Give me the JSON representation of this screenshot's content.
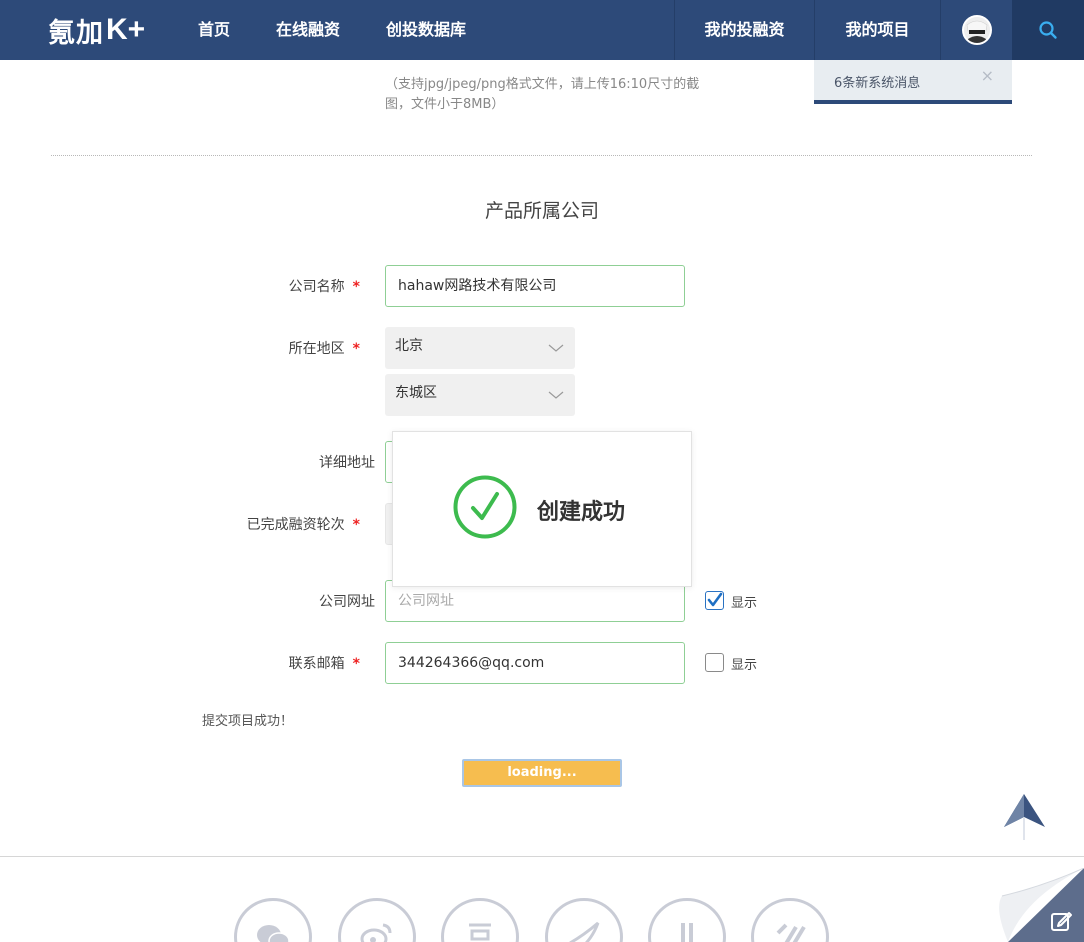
{
  "header": {
    "logo_text": "氪加",
    "logo_mark": "K+",
    "nav": [
      "首页",
      "在线融资",
      "创投数据库"
    ],
    "right_nav": [
      "我的投融资",
      "我的项目"
    ]
  },
  "notification": {
    "text": "6条新系统消息",
    "close": "×"
  },
  "upload_hint": "（支持jpg/jpeg/png格式文件，请上传16:10尺寸的截图，文件小于8MB）",
  "section_title": "产品所属公司",
  "form": {
    "required_mark": "*",
    "company_name": {
      "label": "公司名称",
      "value": "hahaw网路技术有限公司"
    },
    "region": {
      "label": "所在地区",
      "province": "北京",
      "district": "东城区"
    },
    "address": {
      "label": "详细地址"
    },
    "rounds": {
      "label": "已完成融资轮次"
    },
    "website": {
      "label": "公司网址",
      "placeholder": "公司网址",
      "show_label": "显示",
      "show_checked": true
    },
    "email": {
      "label": "联系邮箱",
      "value": "344264366@qq.com",
      "show_label": "显示",
      "show_checked": false
    }
  },
  "toast": {
    "text": "创建成功"
  },
  "submit_message": "提交项目成功！",
  "loading_button": "loading...",
  "colors": {
    "header_bg": "#2d4a79",
    "success_green": "#3dbb4e",
    "required_red": "#e22222",
    "loading_orange": "#f6bd4f",
    "input_border": "#8fcf95"
  }
}
